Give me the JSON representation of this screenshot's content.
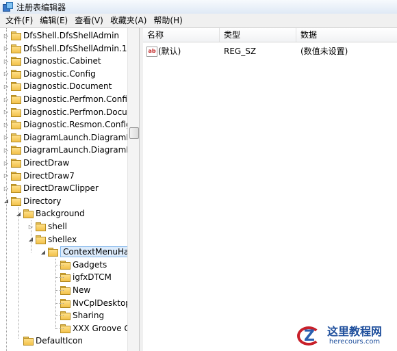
{
  "window": {
    "title": "注册表编辑器"
  },
  "menu": [
    {
      "label": "文件(F)"
    },
    {
      "label": "编辑(E)"
    },
    {
      "label": "查看(V)"
    },
    {
      "label": "收藏夹(A)"
    },
    {
      "label": "帮助(H)"
    }
  ],
  "tree": [
    {
      "label": "DfsShell.DfsShellAdmin",
      "level": 0,
      "expander": "collapsed"
    },
    {
      "label": "DfsShell.DfsShellAdmin.1",
      "level": 0,
      "expander": "collapsed"
    },
    {
      "label": "Diagnostic.Cabinet",
      "level": 0,
      "expander": "collapsed"
    },
    {
      "label": "Diagnostic.Config",
      "level": 0,
      "expander": "collapsed"
    },
    {
      "label": "Diagnostic.Document",
      "level": 0,
      "expander": "collapsed"
    },
    {
      "label": "Diagnostic.Perfmon.Config",
      "level": 0,
      "expander": "collapsed"
    },
    {
      "label": "Diagnostic.Perfmon.Docume",
      "level": 0,
      "expander": "collapsed"
    },
    {
      "label": "Diagnostic.Resmon.Config",
      "level": 0,
      "expander": "collapsed"
    },
    {
      "label": "DiagramLaunch.DiagramLau",
      "level": 0,
      "expander": "collapsed"
    },
    {
      "label": "DiagramLaunch.DiagramLau",
      "level": 0,
      "expander": "collapsed"
    },
    {
      "label": "DirectDraw",
      "level": 0,
      "expander": "collapsed"
    },
    {
      "label": "DirectDraw7",
      "level": 0,
      "expander": "collapsed"
    },
    {
      "label": "DirectDrawClipper",
      "level": 0,
      "expander": "collapsed"
    },
    {
      "label": "Directory",
      "level": 0,
      "expander": "expanded"
    },
    {
      "label": "Background",
      "level": 1,
      "expander": "expanded"
    },
    {
      "label": "shell",
      "level": 2,
      "expander": "collapsed"
    },
    {
      "label": "shellex",
      "level": 2,
      "expander": "expanded"
    },
    {
      "label": "ContextMenuHand",
      "level": 3,
      "expander": "expanded",
      "selected": true
    },
    {
      "label": "Gadgets",
      "level": 4,
      "expander": "none"
    },
    {
      "label": "igfxDTCM",
      "level": 4,
      "expander": "none"
    },
    {
      "label": "New",
      "level": 4,
      "expander": "none"
    },
    {
      "label": "NvCplDesktop(",
      "level": 4,
      "expander": "none"
    },
    {
      "label": "Sharing",
      "level": 4,
      "expander": "none"
    },
    {
      "label": "XXX Groove Gl",
      "level": 4,
      "expander": "none"
    },
    {
      "label": "DefaultIcon",
      "level": 1,
      "expander": "none"
    }
  ],
  "list": {
    "columns": [
      "名称",
      "类型",
      "数据"
    ],
    "rows": [
      {
        "name": "(默认)",
        "type": "REG_SZ",
        "data": "(数值未设置)",
        "icon_text": "ab"
      }
    ]
  },
  "watermark": {
    "title": "这里教程网",
    "url": "herecours.com"
  },
  "colors": {
    "selection_bg": "#dcebfb",
    "selection_border": "#7eb4ea",
    "folder": "#f2c14a"
  }
}
